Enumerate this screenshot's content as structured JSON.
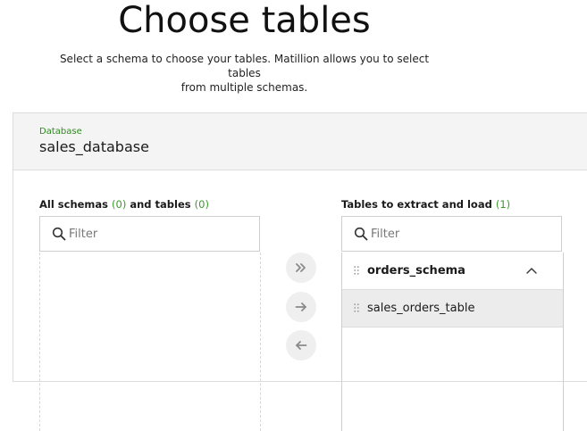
{
  "page": {
    "title": "Choose tables",
    "subtitle_line1": "Select a schema to choose your tables. Matillion allows you to select tables",
    "subtitle_line2": "from multiple schemas."
  },
  "database": {
    "label": "Database",
    "name": "sales_database"
  },
  "left_column": {
    "title_part1": "All schemas",
    "schemas_count": "(0)",
    "title_part2": "and tables",
    "tables_count": "(0)",
    "filter_placeholder": "Filter"
  },
  "right_column": {
    "title": "Tables to extract and load",
    "count": "(1)",
    "filter_placeholder": "Filter",
    "schema": "orders_schema",
    "tables": [
      "sales_orders_table"
    ]
  },
  "transfer_buttons": [
    "add-all",
    "add-selected",
    "remove-selected"
  ],
  "colors": {
    "accent_green": "#3a9a28",
    "label_green": "#2e8b1e",
    "header_bg": "#f4f4f4",
    "selected_row_bg": "#ececec",
    "button_bg": "#efefef"
  }
}
